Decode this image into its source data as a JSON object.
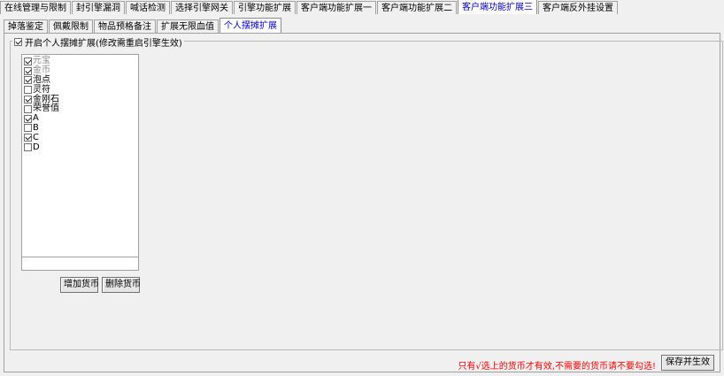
{
  "top_tabs": [
    {
      "label": "在线管理与限制"
    },
    {
      "label": "封引擎漏洞"
    },
    {
      "label": "喊话检测"
    },
    {
      "label": "选择引擎网关"
    },
    {
      "label": "引擎功能扩展"
    },
    {
      "label": "客户端功能扩展一"
    },
    {
      "label": "客户端功能扩展二"
    },
    {
      "label": "客户端功能扩展三",
      "active": true
    },
    {
      "label": "客户端反外挂设置"
    }
  ],
  "sub_tabs": [
    {
      "label": "掉落鉴定"
    },
    {
      "label": "佩戴限制"
    },
    {
      "label": "物品预格备注"
    },
    {
      "label": "扩展无限血值"
    },
    {
      "label": "个人摆摊扩展",
      "active": true
    }
  ],
  "group": {
    "title": "开启个人摆摊扩展(修改需重启引擎生效)",
    "enabled": true
  },
  "currency_list": [
    {
      "label": "元宝",
      "checked": true,
      "disabled": true
    },
    {
      "label": "金币",
      "checked": true,
      "disabled": true
    },
    {
      "label": "泡点",
      "checked": true,
      "disabled": false
    },
    {
      "label": "灵符",
      "checked": false,
      "disabled": false
    },
    {
      "label": "金刚石",
      "checked": true,
      "disabled": false
    },
    {
      "label": "荣誉值",
      "checked": false,
      "disabled": false
    },
    {
      "label": "A",
      "checked": true,
      "disabled": false
    },
    {
      "label": "B",
      "checked": false,
      "disabled": false
    },
    {
      "label": "C",
      "checked": true,
      "disabled": false
    },
    {
      "label": "D",
      "checked": false,
      "disabled": false
    }
  ],
  "currency_input": {
    "value": ""
  },
  "buttons": {
    "add": "增加货币",
    "delete": "删除货币",
    "save": "保存并生效"
  },
  "notice": "只有√选上的货币才有效,不需要的货币请不要勾选!",
  "colors": {
    "active_tab": "#0000cc",
    "notice": "#ff0000"
  }
}
